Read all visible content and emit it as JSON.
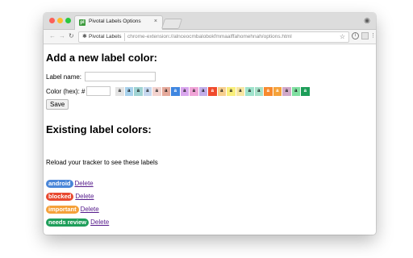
{
  "browser": {
    "tab_title": "Pivotal Labels Options",
    "tab_close": "×",
    "favicon_text": "pl",
    "url_origin": "Pivotal Labels",
    "url_path": "chrome-extension://alnceocmbalobokfmmaalffahomehnah/options.html",
    "icons": {
      "back": "back-arrow-icon",
      "forward": "forward-arrow-icon",
      "reload": "reload-icon",
      "extension": "puzzle-icon",
      "star": "star-icon",
      "info": "info-icon",
      "profile": "profile-icon",
      "menu": "kebab-menu-icon"
    }
  },
  "add_section": {
    "heading": "Add a new label color:",
    "name_label": "Label name:",
    "name_value": "",
    "color_label": "Color (hex): #",
    "color_value": "",
    "save_label": "Save",
    "swatches": [
      {
        "letter": "a",
        "color": "#e3e3e3",
        "dark": false
      },
      {
        "letter": "a",
        "color": "#a7d1ec",
        "dark": false
      },
      {
        "letter": "a",
        "color": "#9fd3d3",
        "dark": false
      },
      {
        "letter": "a",
        "color": "#c5d7ef",
        "dark": false
      },
      {
        "letter": "a",
        "color": "#f3d3cf",
        "dark": false
      },
      {
        "letter": "a",
        "color": "#e5a99b",
        "dark": false
      },
      {
        "letter": "a",
        "color": "#3f86e0",
        "dark": true
      },
      {
        "letter": "a",
        "color": "#d9a6ee",
        "dark": false
      },
      {
        "letter": "a",
        "color": "#f0a4d7",
        "dark": false
      },
      {
        "letter": "a",
        "color": "#c2aee9",
        "dark": false
      },
      {
        "letter": "a",
        "color": "#f04a2c",
        "dark": true
      },
      {
        "letter": "a",
        "color": "#f7cf8f",
        "dark": false
      },
      {
        "letter": "a",
        "color": "#f9ef7c",
        "dark": false
      },
      {
        "letter": "a",
        "color": "#f8e6a2",
        "dark": false
      },
      {
        "letter": "a",
        "color": "#9ee2cb",
        "dark": false
      },
      {
        "letter": "a",
        "color": "#a6e0c8",
        "dark": false
      },
      {
        "letter": "a",
        "color": "#f7892e",
        "dark": true
      },
      {
        "letter": "a",
        "color": "#f5a23a",
        "dark": true
      },
      {
        "letter": "a",
        "color": "#d0a8c8",
        "dark": false
      },
      {
        "letter": "a",
        "color": "#7fdfa0",
        "dark": false
      },
      {
        "letter": "a",
        "color": "#1c9d58",
        "dark": true
      }
    ]
  },
  "existing_section": {
    "heading": "Existing label colors:",
    "note": "Reload your tracker to see these labels",
    "delete_label": "Delete",
    "labels": [
      {
        "name": "android",
        "color": "#4a86d8"
      },
      {
        "name": "blocked",
        "color": "#e8482f"
      },
      {
        "name": "important",
        "color": "#f5a13a"
      },
      {
        "name": "needs review",
        "color": "#1e9e5a"
      }
    ]
  }
}
